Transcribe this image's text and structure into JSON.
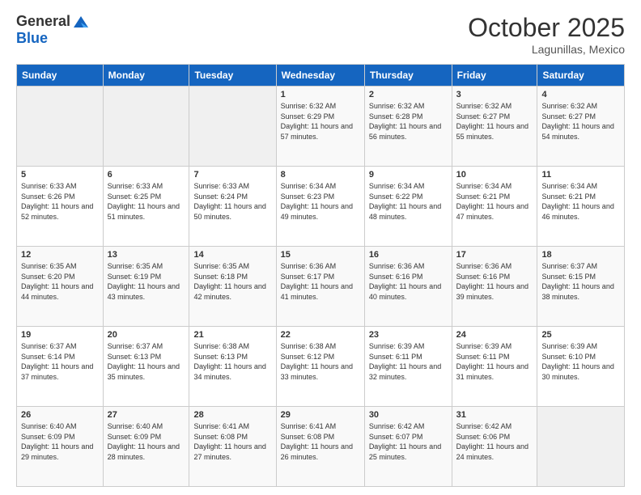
{
  "header": {
    "logo_general": "General",
    "logo_blue": "Blue",
    "month_title": "October 2025",
    "location": "Lagunillas, Mexico"
  },
  "weekdays": [
    "Sunday",
    "Monday",
    "Tuesday",
    "Wednesday",
    "Thursday",
    "Friday",
    "Saturday"
  ],
  "weeks": [
    [
      {
        "day": "",
        "sunrise": "",
        "sunset": "",
        "daylight": ""
      },
      {
        "day": "",
        "sunrise": "",
        "sunset": "",
        "daylight": ""
      },
      {
        "day": "",
        "sunrise": "",
        "sunset": "",
        "daylight": ""
      },
      {
        "day": "1",
        "sunrise": "6:32 AM",
        "sunset": "6:29 PM",
        "daylight": "11 hours and 57 minutes."
      },
      {
        "day": "2",
        "sunrise": "6:32 AM",
        "sunset": "6:28 PM",
        "daylight": "11 hours and 56 minutes."
      },
      {
        "day": "3",
        "sunrise": "6:32 AM",
        "sunset": "6:27 PM",
        "daylight": "11 hours and 55 minutes."
      },
      {
        "day": "4",
        "sunrise": "6:32 AM",
        "sunset": "6:27 PM",
        "daylight": "11 hours and 54 minutes."
      }
    ],
    [
      {
        "day": "5",
        "sunrise": "6:33 AM",
        "sunset": "6:26 PM",
        "daylight": "11 hours and 52 minutes."
      },
      {
        "day": "6",
        "sunrise": "6:33 AM",
        "sunset": "6:25 PM",
        "daylight": "11 hours and 51 minutes."
      },
      {
        "day": "7",
        "sunrise": "6:33 AM",
        "sunset": "6:24 PM",
        "daylight": "11 hours and 50 minutes."
      },
      {
        "day": "8",
        "sunrise": "6:34 AM",
        "sunset": "6:23 PM",
        "daylight": "11 hours and 49 minutes."
      },
      {
        "day": "9",
        "sunrise": "6:34 AM",
        "sunset": "6:22 PM",
        "daylight": "11 hours and 48 minutes."
      },
      {
        "day": "10",
        "sunrise": "6:34 AM",
        "sunset": "6:21 PM",
        "daylight": "11 hours and 47 minutes."
      },
      {
        "day": "11",
        "sunrise": "6:34 AM",
        "sunset": "6:21 PM",
        "daylight": "11 hours and 46 minutes."
      }
    ],
    [
      {
        "day": "12",
        "sunrise": "6:35 AM",
        "sunset": "6:20 PM",
        "daylight": "11 hours and 44 minutes."
      },
      {
        "day": "13",
        "sunrise": "6:35 AM",
        "sunset": "6:19 PM",
        "daylight": "11 hours and 43 minutes."
      },
      {
        "day": "14",
        "sunrise": "6:35 AM",
        "sunset": "6:18 PM",
        "daylight": "11 hours and 42 minutes."
      },
      {
        "day": "15",
        "sunrise": "6:36 AM",
        "sunset": "6:17 PM",
        "daylight": "11 hours and 41 minutes."
      },
      {
        "day": "16",
        "sunrise": "6:36 AM",
        "sunset": "6:16 PM",
        "daylight": "11 hours and 40 minutes."
      },
      {
        "day": "17",
        "sunrise": "6:36 AM",
        "sunset": "6:16 PM",
        "daylight": "11 hours and 39 minutes."
      },
      {
        "day": "18",
        "sunrise": "6:37 AM",
        "sunset": "6:15 PM",
        "daylight": "11 hours and 38 minutes."
      }
    ],
    [
      {
        "day": "19",
        "sunrise": "6:37 AM",
        "sunset": "6:14 PM",
        "daylight": "11 hours and 37 minutes."
      },
      {
        "day": "20",
        "sunrise": "6:37 AM",
        "sunset": "6:13 PM",
        "daylight": "11 hours and 35 minutes."
      },
      {
        "day": "21",
        "sunrise": "6:38 AM",
        "sunset": "6:13 PM",
        "daylight": "11 hours and 34 minutes."
      },
      {
        "day": "22",
        "sunrise": "6:38 AM",
        "sunset": "6:12 PM",
        "daylight": "11 hours and 33 minutes."
      },
      {
        "day": "23",
        "sunrise": "6:39 AM",
        "sunset": "6:11 PM",
        "daylight": "11 hours and 32 minutes."
      },
      {
        "day": "24",
        "sunrise": "6:39 AM",
        "sunset": "6:11 PM",
        "daylight": "11 hours and 31 minutes."
      },
      {
        "day": "25",
        "sunrise": "6:39 AM",
        "sunset": "6:10 PM",
        "daylight": "11 hours and 30 minutes."
      }
    ],
    [
      {
        "day": "26",
        "sunrise": "6:40 AM",
        "sunset": "6:09 PM",
        "daylight": "11 hours and 29 minutes."
      },
      {
        "day": "27",
        "sunrise": "6:40 AM",
        "sunset": "6:09 PM",
        "daylight": "11 hours and 28 minutes."
      },
      {
        "day": "28",
        "sunrise": "6:41 AM",
        "sunset": "6:08 PM",
        "daylight": "11 hours and 27 minutes."
      },
      {
        "day": "29",
        "sunrise": "6:41 AM",
        "sunset": "6:08 PM",
        "daylight": "11 hours and 26 minutes."
      },
      {
        "day": "30",
        "sunrise": "6:42 AM",
        "sunset": "6:07 PM",
        "daylight": "11 hours and 25 minutes."
      },
      {
        "day": "31",
        "sunrise": "6:42 AM",
        "sunset": "6:06 PM",
        "daylight": "11 hours and 24 minutes."
      },
      {
        "day": "",
        "sunrise": "",
        "sunset": "",
        "daylight": ""
      }
    ]
  ]
}
